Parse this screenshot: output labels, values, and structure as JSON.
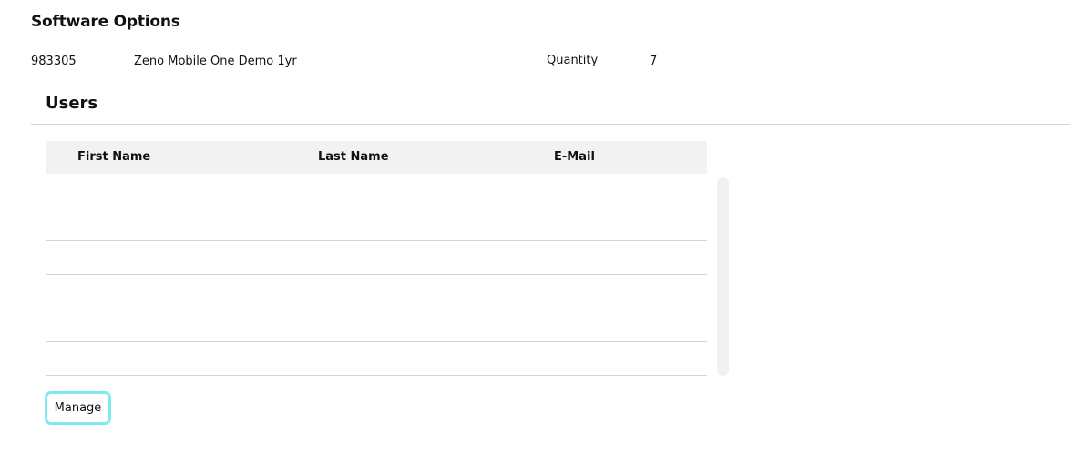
{
  "software_options": {
    "title": "Software Options",
    "items": [
      {
        "id": "983305",
        "name": "Zeno Mobile One Demo 1yr",
        "quantity_label": "Quantity",
        "quantity": "7"
      }
    ]
  },
  "users": {
    "title": "Users",
    "columns": [
      "First Name",
      "Last Name",
      "E-Mail"
    ],
    "rows": [
      [
        "",
        "",
        ""
      ],
      [
        "",
        "",
        ""
      ],
      [
        "",
        "",
        ""
      ],
      [
        "",
        "",
        ""
      ],
      [
        "",
        "",
        ""
      ],
      [
        "",
        "",
        ""
      ]
    ]
  },
  "actions": {
    "manage_label": "Manage"
  },
  "colors": {
    "header_bg": "#f2f2f2",
    "divider": "#d4d4d4",
    "focus_ring": "#7fe9ef"
  }
}
